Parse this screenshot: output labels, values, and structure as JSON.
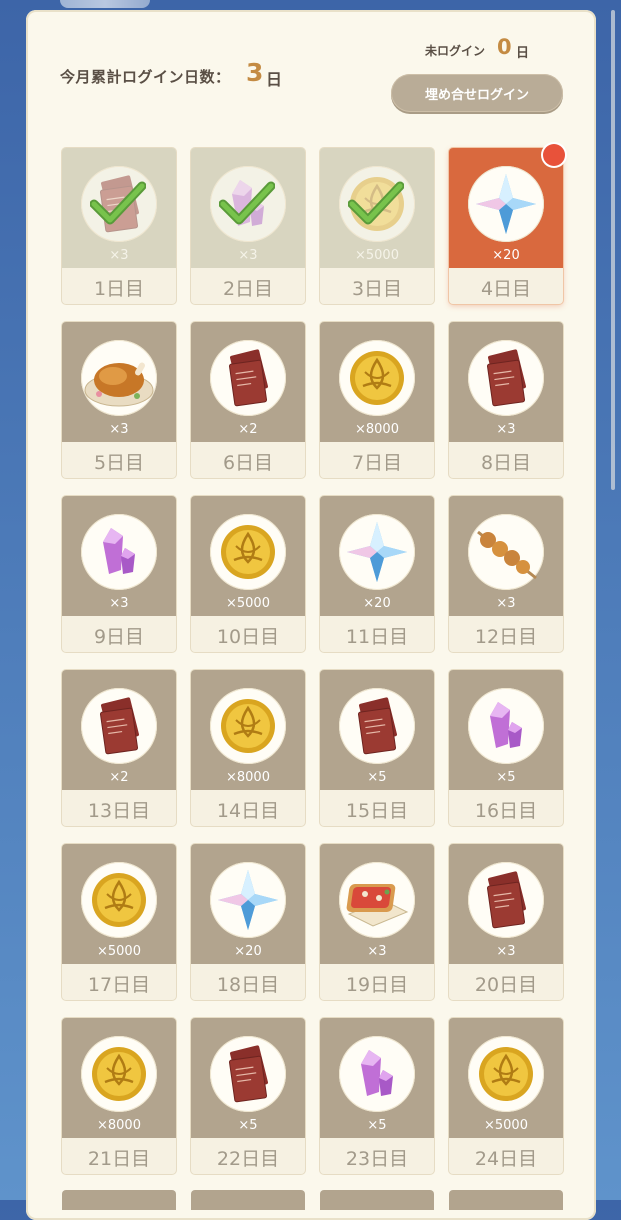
{
  "header": {
    "cumulative_label": "今月累計ログイン日数：",
    "cumulative_days": "3",
    "cumulative_unit": "日",
    "missed_label": "未ログイン",
    "missed_days": "0",
    "missed_unit": "日",
    "makeup_button": "埋め合せログイン"
  },
  "colors": {
    "accent": "#c48b43",
    "today": "#d9693e",
    "card_bg": "#b2a48e",
    "claimed_bg": "#d8d5c0",
    "badge": "#e8523a"
  },
  "rewards": [
    {
      "day": "1日目",
      "qty": "×3",
      "icon": "letter-icon",
      "state": "claimed"
    },
    {
      "day": "2日目",
      "qty": "×3",
      "icon": "crystal-icon",
      "state": "claimed"
    },
    {
      "day": "3日目",
      "qty": "×5000",
      "icon": "coin-icon",
      "state": "claimed"
    },
    {
      "day": "4日目",
      "qty": "×20",
      "icon": "star-gem-icon",
      "state": "today"
    },
    {
      "day": "5日目",
      "qty": "×3",
      "icon": "roast-chicken-icon",
      "state": "locked"
    },
    {
      "day": "6日目",
      "qty": "×2",
      "icon": "letter-icon",
      "state": "locked"
    },
    {
      "day": "7日目",
      "qty": "×8000",
      "icon": "coin-icon",
      "state": "locked"
    },
    {
      "day": "8日目",
      "qty": "×3",
      "icon": "letter-icon",
      "state": "locked"
    },
    {
      "day": "9日目",
      "qty": "×3",
      "icon": "crystal-icon",
      "state": "locked"
    },
    {
      "day": "10日目",
      "qty": "×5000",
      "icon": "coin-icon",
      "state": "locked"
    },
    {
      "day": "11日目",
      "qty": "×20",
      "icon": "star-gem-icon",
      "state": "locked"
    },
    {
      "day": "12日目",
      "qty": "×3",
      "icon": "skewer-icon",
      "state": "locked"
    },
    {
      "day": "13日目",
      "qty": "×2",
      "icon": "letter-icon",
      "state": "locked"
    },
    {
      "day": "14日目",
      "qty": "×8000",
      "icon": "coin-icon",
      "state": "locked"
    },
    {
      "day": "15日目",
      "qty": "×5",
      "icon": "letter-icon",
      "state": "locked"
    },
    {
      "day": "16日目",
      "qty": "×5",
      "icon": "crystal-icon",
      "state": "locked"
    },
    {
      "day": "17日目",
      "qty": "×5000",
      "icon": "coin-icon",
      "state": "locked"
    },
    {
      "day": "18日目",
      "qty": "×20",
      "icon": "star-gem-icon",
      "state": "locked"
    },
    {
      "day": "19日目",
      "qty": "×3",
      "icon": "pizza-toast-icon",
      "state": "locked"
    },
    {
      "day": "20日目",
      "qty": "×3",
      "icon": "letter-icon",
      "state": "locked"
    },
    {
      "day": "21日目",
      "qty": "×8000",
      "icon": "coin-icon",
      "state": "locked"
    },
    {
      "day": "22日目",
      "qty": "×5",
      "icon": "letter-icon",
      "state": "locked"
    },
    {
      "day": "23日目",
      "qty": "×5",
      "icon": "crystal-icon",
      "state": "locked"
    },
    {
      "day": "24日目",
      "qty": "×5000",
      "icon": "coin-icon",
      "state": "locked"
    }
  ]
}
